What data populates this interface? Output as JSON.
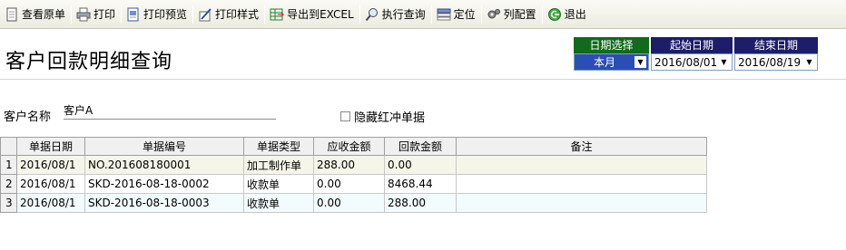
{
  "toolbar": {
    "items": [
      {
        "label": "查看原单",
        "icon": "document-icon"
      },
      {
        "label": "打印",
        "icon": "printer-icon"
      },
      {
        "label": "打印预览",
        "icon": "print-preview-icon"
      },
      {
        "label": "打印样式",
        "icon": "print-style-icon"
      },
      {
        "label": "导出到EXCEL",
        "icon": "excel-export-icon"
      },
      {
        "label": "执行查询",
        "icon": "magnifier-icon"
      },
      {
        "label": "定位",
        "icon": "locate-icon"
      },
      {
        "label": "列配置",
        "icon": "column-config-icon"
      },
      {
        "label": "退出",
        "icon": "exit-icon"
      }
    ]
  },
  "page_title": "客户回款明细查询",
  "date_filter": {
    "period_header": "日期选择",
    "period_value": "本月",
    "start_header": "起始日期",
    "start_value": "2016/08/01",
    "end_header": "结束日期",
    "end_value": "2016/08/19"
  },
  "customer": {
    "label": "客户名称",
    "value": "客户A"
  },
  "hide_reversal": {
    "label": "隐藏红冲单据",
    "checked": false
  },
  "grid": {
    "columns": [
      "单据日期",
      "单据编号",
      "单据类型",
      "应收金额",
      "回款金额",
      "备注"
    ],
    "rows": [
      {
        "no": "1",
        "date": "2016/08/1",
        "code": "NO.201608180001",
        "type": "加工制作单",
        "receivable": "288.00",
        "received": "0.00",
        "note": ""
      },
      {
        "no": "2",
        "date": "2016/08/1",
        "code": "SKD-2016-08-18-0002",
        "type": "收款单",
        "receivable": "0.00",
        "received": "8468.44",
        "note": ""
      },
      {
        "no": "3",
        "date": "2016/08/1",
        "code": "SKD-2016-08-18-0003",
        "type": "收款单",
        "receivable": "0.00",
        "received": "288.00",
        "note": ""
      }
    ]
  },
  "colors": {
    "period_header_bg": "#116b1b",
    "date_header_bg": "#1d1d6b",
    "period_select_bg": "#2b4eb5"
  }
}
